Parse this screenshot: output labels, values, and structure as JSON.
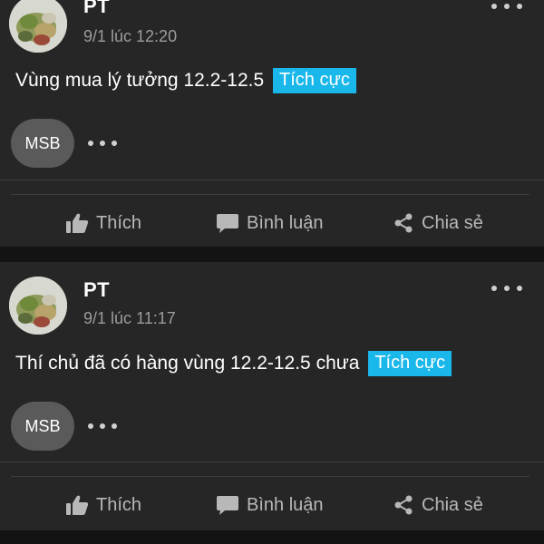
{
  "posts": [
    {
      "author": "PT",
      "time": "9/1 lúc 12:20",
      "text": "Vùng mua lý tưởng 12.2-12.5",
      "sentiment": "Tích cực",
      "stock": "MSB",
      "actions": {
        "like": "Thích",
        "comment": "Bình luận",
        "share": "Chia sẻ"
      }
    },
    {
      "author": "PT",
      "time": "9/1 lúc 11:17",
      "text": "Thí chủ đã có hàng vùng 12.2-12.5 chưa",
      "sentiment": "Tích cực",
      "stock": "MSB",
      "actions": {
        "like": "Thích",
        "comment": "Bình luận",
        "share": "Chia sẻ"
      }
    }
  ],
  "colors": {
    "background": "#131313",
    "card": "#262626",
    "tag": "#19b7ea",
    "chip": "#5a5a5a",
    "muted": "#9c9c9c",
    "action": "#b8b8b8"
  },
  "icons": [
    "more-horizontal-icon",
    "thumbs-up-icon",
    "comment-icon",
    "share-icon"
  ]
}
